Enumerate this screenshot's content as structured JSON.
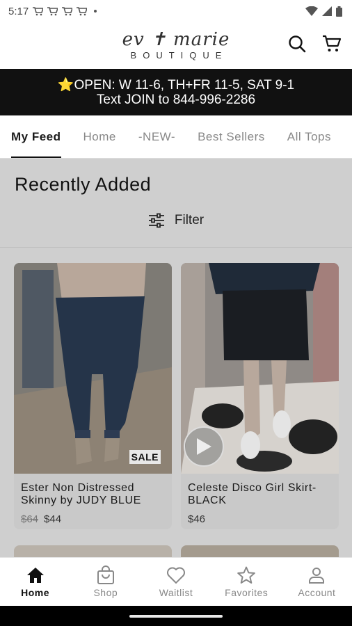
{
  "status_bar": {
    "time": "5:17"
  },
  "header": {
    "logo_script": "ev ✝ marie",
    "logo_sub": "BOUTIQUE",
    "search_icon": "search-icon",
    "cart_icon": "cart-icon"
  },
  "announcement": {
    "line1": "⭐OPEN: W 11-6, TH+FR 11-5, SAT 9-1",
    "line2": "Text JOIN to 844-996-2286"
  },
  "tabs": [
    {
      "label": "My Feed",
      "active": true
    },
    {
      "label": "Home"
    },
    {
      "label": "-NEW-"
    },
    {
      "label": "Best Sellers"
    },
    {
      "label": "All Tops"
    }
  ],
  "feed": {
    "title": "Recently Added",
    "filter_label": "Filter",
    "products": [
      {
        "name": "Ester Non Distressed Skinny by JUDY BLUE",
        "old_price": "$64",
        "price": "$44",
        "badge": "SALE"
      },
      {
        "name": "Celeste Disco Girl Skirt-BLACK",
        "price": "$46"
      }
    ]
  },
  "bottom_nav": [
    {
      "label": "Home",
      "icon": "home-icon",
      "active": true
    },
    {
      "label": "Shop",
      "icon": "shopping-bag-icon"
    },
    {
      "label": "Waitlist",
      "icon": "heart-icon"
    },
    {
      "label": "Favorites",
      "icon": "star-icon"
    },
    {
      "label": "Account",
      "icon": "person-icon"
    }
  ],
  "colors": {
    "announcement_bg": "#111111",
    "accent": "#111111",
    "inactive": "#888888"
  }
}
